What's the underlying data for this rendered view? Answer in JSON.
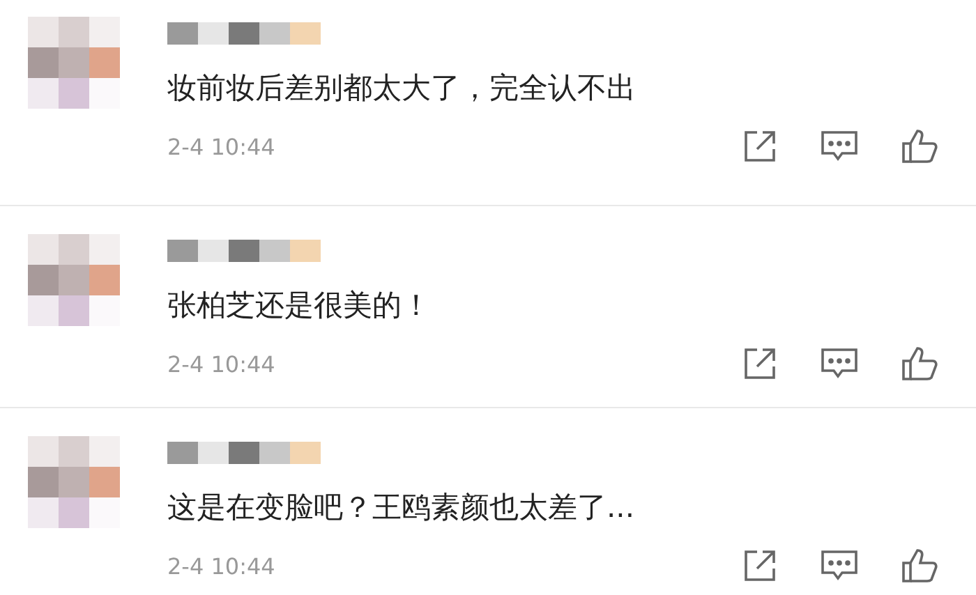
{
  "comments": [
    {
      "text": "妆前妆后差别都太大了，完全认不出",
      "time": "2-4 10:44"
    },
    {
      "text": "张柏芝还是很美的！",
      "time": "2-4 10:44"
    },
    {
      "text": "这是在变脸吧？王鸥素颜也太差了...",
      "time": "2-4 10:44"
    }
  ]
}
